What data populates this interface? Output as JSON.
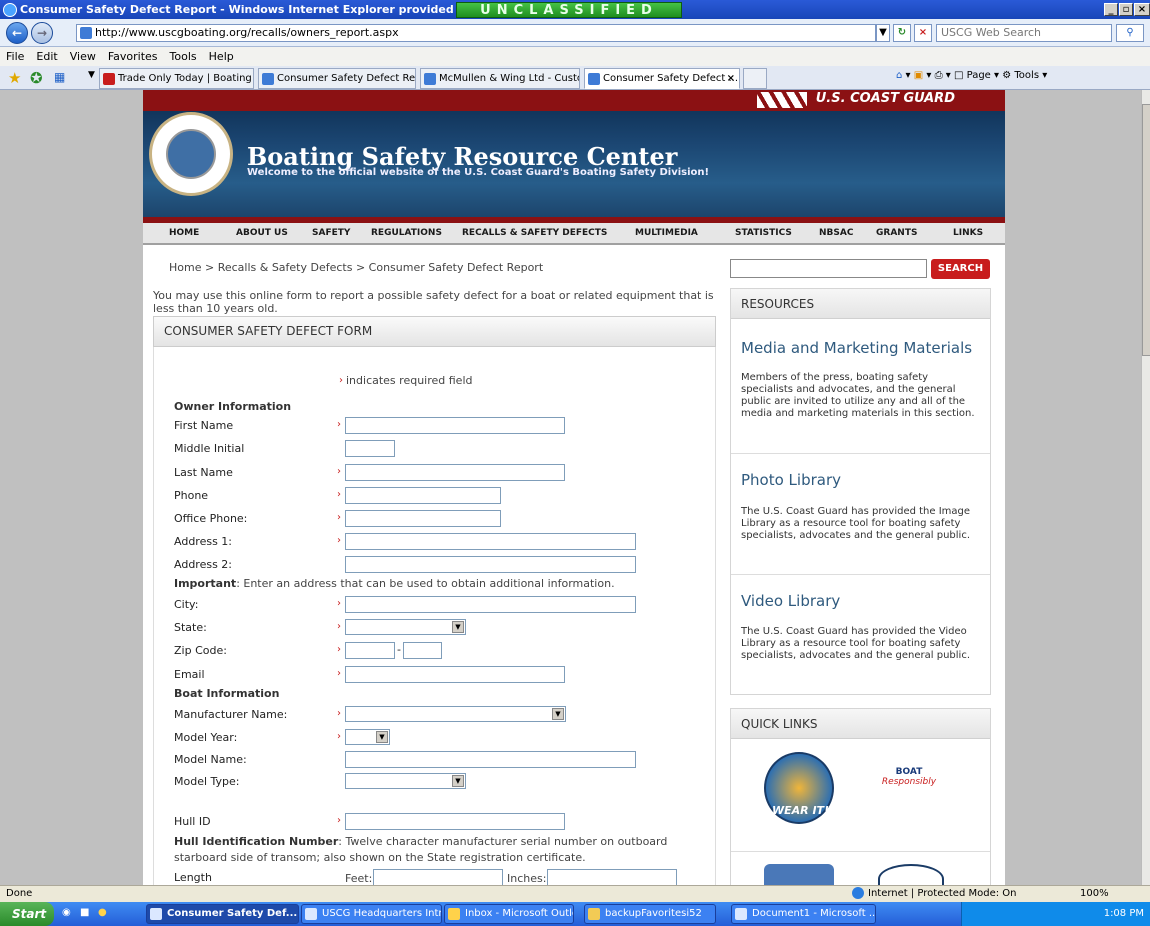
{
  "window": {
    "title": "Consumer Safety Defect Report - Windows Internet Explorer provided by U. S. Coast Gu",
    "banner_classification": "UNCLASSIFIED",
    "min_label": "_",
    "max_label": "▫",
    "close_label": "×"
  },
  "address_bar": {
    "url": "http://www.uscgboating.org/recalls/owners_report.aspx",
    "search_placeholder": "USCG Web Search"
  },
  "menu": [
    "File",
    "Edit",
    "View",
    "Favorites",
    "Tools",
    "Help"
  ],
  "tabs": [
    {
      "label": "Trade Only Today | Boating ..."
    },
    {
      "label": "Consumer Safety Defect Re..."
    },
    {
      "label": "McMullen & Wing Ltd - Custo..."
    },
    {
      "label": "Consumer Safety Defect ..."
    }
  ],
  "command_bar": {
    "page": "Page",
    "tools": "Tools"
  },
  "site": {
    "agency": "U.S. COAST GUARD",
    "title": "Boating Safety Resource Center",
    "welcome": "Welcome to the official website of the U.S. Coast Guard's Boating Safety Division!",
    "nav": [
      "HOME",
      "ABOUT US",
      "SAFETY",
      "REGULATIONS",
      "RECALLS & SAFETY DEFECTS",
      "MULTIMEDIA",
      "STATISTICS",
      "NBSAC",
      "GRANTS",
      "LINKS"
    ],
    "breadcrumb": "Home > Recalls & Safety Defects > Consumer Safety Defect Report",
    "intro": "You may use this online form to report a possible safety defect for a boat or related equipment that is less than 10 years old."
  },
  "form": {
    "heading": "CONSUMER SAFETY DEFECT FORM",
    "required_note": "indicates required field",
    "owner_section": "Owner Information",
    "labels": {
      "first_name": "First Name",
      "middle_initial": "Middle Initial",
      "last_name": "Last Name",
      "phone": "Phone",
      "office_phone": "Office Phone:",
      "address1": "Address 1:",
      "address2": "Address 2:",
      "city": "City:",
      "state": "State:",
      "zip": "Zip Code:",
      "email": "Email",
      "manufacturer": "Manufacturer Name:",
      "model_year": "Model Year:",
      "model_name": "Model Name:",
      "model_type": "Model Type:",
      "hull_id": "Hull ID",
      "length": "Length",
      "feet": "Feet:",
      "inches": "Inches:"
    },
    "important_bold": "Important",
    "important_text": ": Enter an address that can be used to obtain additional information.",
    "boat_section": "Boat Information",
    "hin_bold": "Hull Identification Number",
    "hin_text_1": ": Twelve character manufacturer serial number on outboard",
    "hin_text_2": "starboard side of transom; also shown on the State registration certificate.",
    "zip_dash": "-"
  },
  "sidebar": {
    "search_button": "SEARCH",
    "resources_heading": "RESOURCES",
    "items": [
      {
        "title": "Media and Marketing Materials",
        "text": "Members of the press, boating safety specialists and advocates, and the general public are invited to utilize any and all of the media and marketing materials in this section."
      },
      {
        "title": "Photo Library",
        "text": "The U.S. Coast Guard has provided the Image Library as a resource tool for boating safety specialists, advocates and the general public."
      },
      {
        "title": "Video Library",
        "text": "The U.S. Coast Guard has provided the Video Library as a resource tool for boating safety specialists, advocates and the general public."
      }
    ],
    "quick_links_heading": "QUICK LINKS",
    "wear_it": "WEAR IT!",
    "boat_responsibly_1": "BOAT",
    "boat_responsibly_2": "Responsibly"
  },
  "status": {
    "left": "Done",
    "zone": "Internet | Protected Mode: On",
    "zoom": "100%"
  },
  "taskbar": {
    "start": "Start",
    "buttons": [
      {
        "label": "Consumer Safety Def..."
      },
      {
        "label": "USCG Headquarters Intr..."
      },
      {
        "label": "Inbox - Microsoft Outlook"
      },
      {
        "label": "backupFavoritesi52"
      },
      {
        "label": "Document1 - Microsoft ..."
      }
    ],
    "clock": "1:08 PM"
  }
}
